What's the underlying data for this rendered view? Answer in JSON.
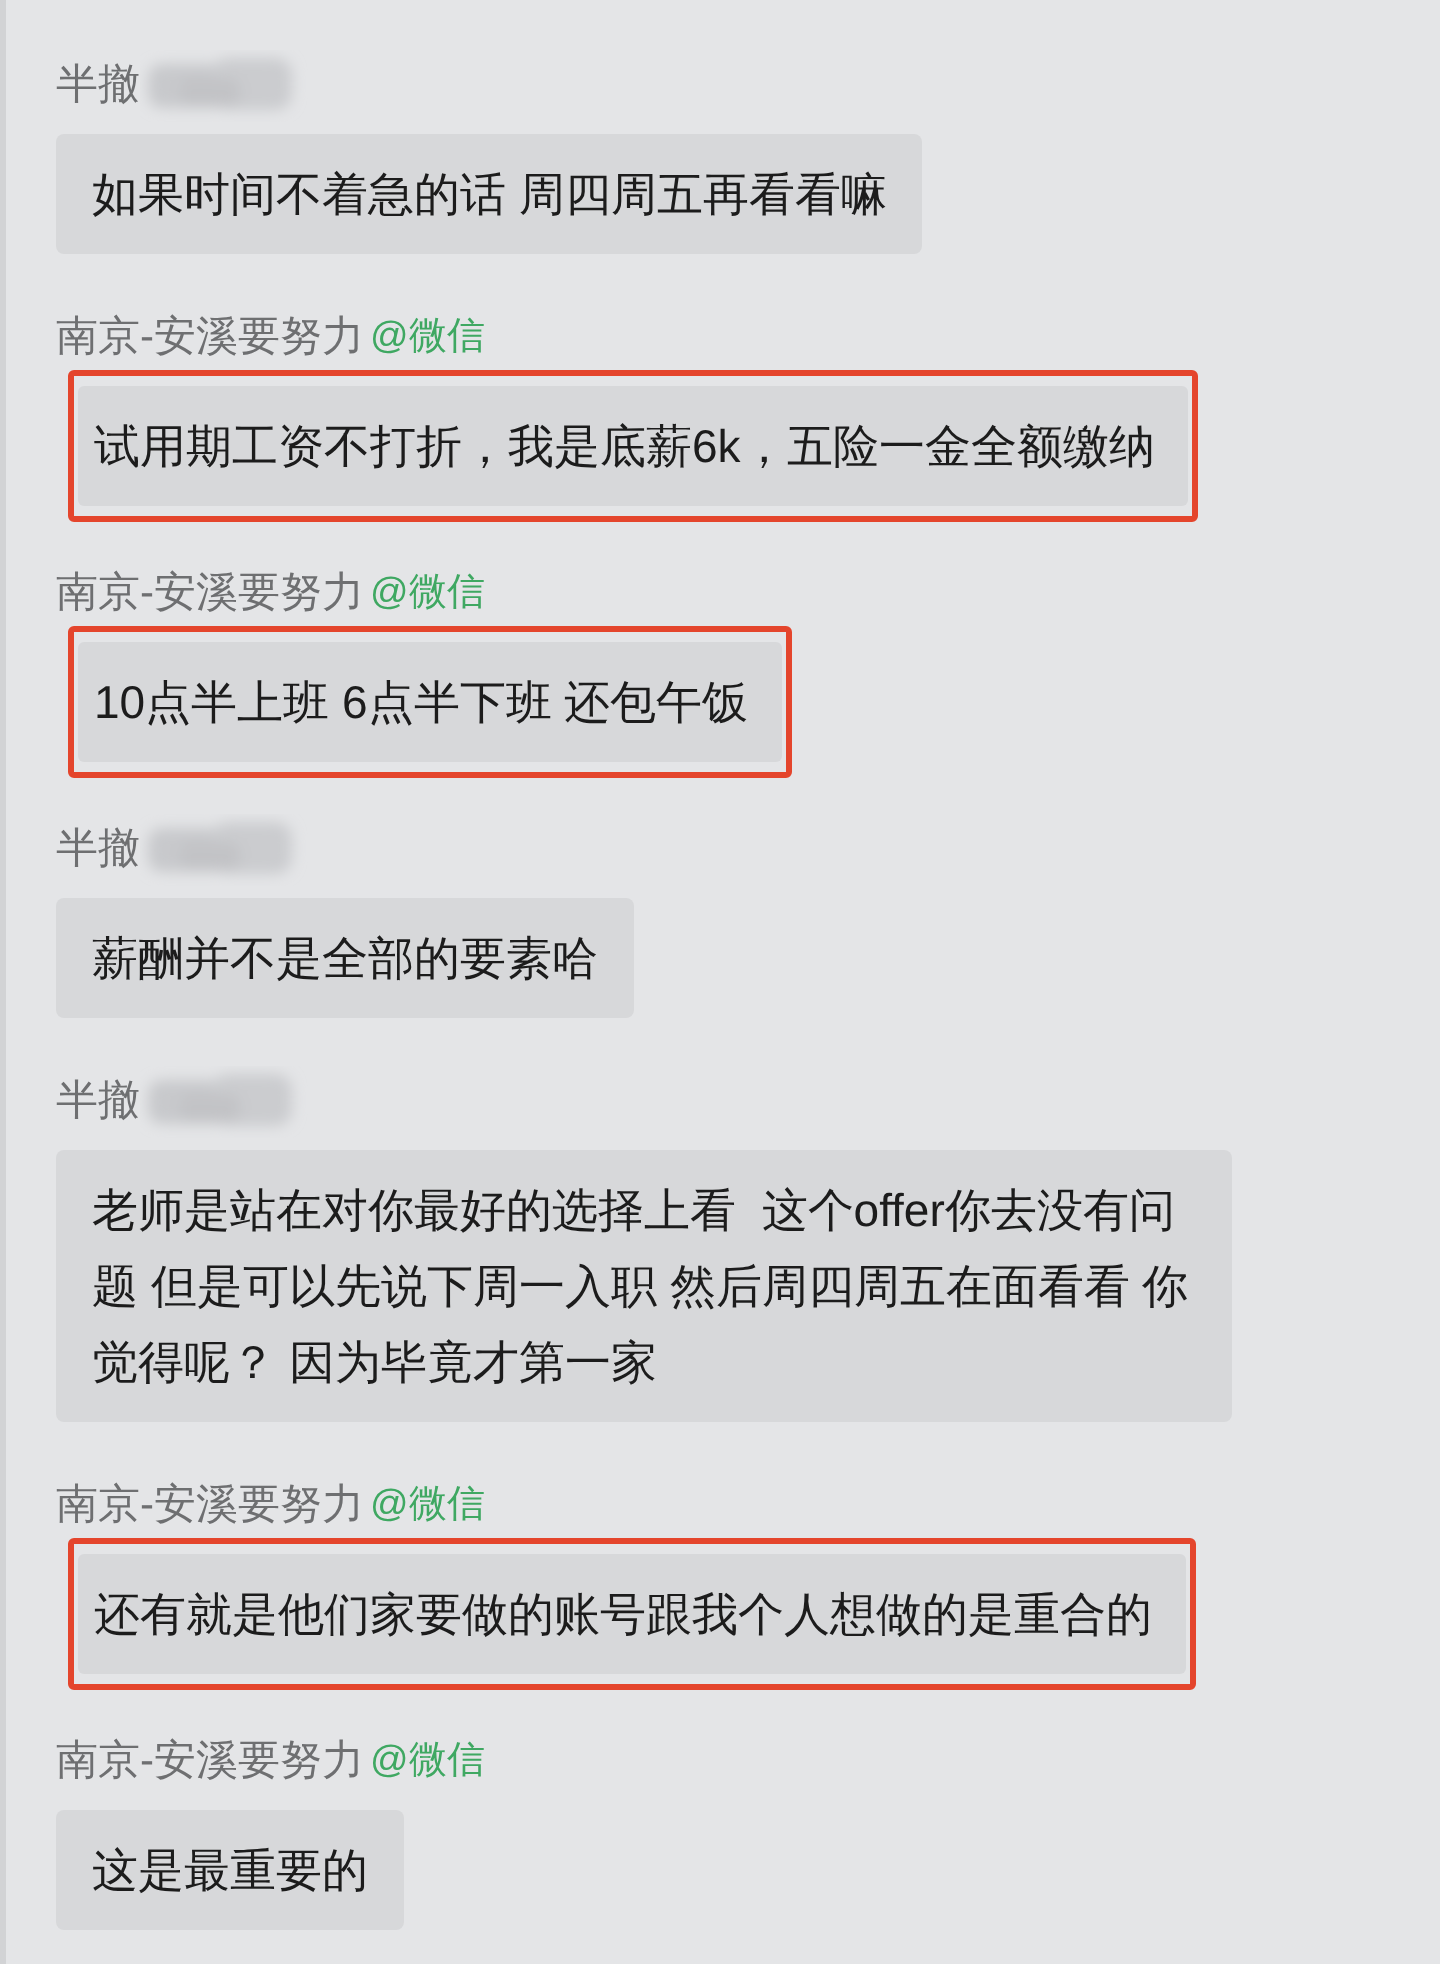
{
  "messages": [
    {
      "sender": {
        "name": "半撤",
        "redacted": true
      },
      "text": "如果时间不着急的话 周四周五再看看嘛",
      "highlighted": false
    },
    {
      "sender": {
        "name": "南京-安溪要努力",
        "source": "@微信",
        "redacted": false
      },
      "text": "试用期工资不打折，我是底薪6k，五险一金全额缴纳",
      "highlighted": true
    },
    {
      "sender": {
        "name": "南京-安溪要努力",
        "source": "@微信",
        "redacted": false
      },
      "text": "10点半上班 6点半下班 还包午饭",
      "highlighted": true
    },
    {
      "sender": {
        "name": "半撤",
        "redacted": true
      },
      "text": "薪酬并不是全部的要素哈",
      "highlighted": false
    },
    {
      "sender": {
        "name": "半撤",
        "redacted": true
      },
      "text": "老师是站在对你最好的选择上看  这个offer你去没有问题 但是可以先说下周一入职 然后周四周五在面看看 你觉得呢？ 因为毕竟才第一家",
      "highlighted": false
    },
    {
      "sender": {
        "name": "南京-安溪要努力",
        "source": "@微信",
        "redacted": false
      },
      "text": "还有就是他们家要做的账号跟我个人想做的是重合的",
      "highlighted": true
    },
    {
      "sender": {
        "name": "南京-安溪要努力",
        "source": "@微信",
        "redacted": false
      },
      "text": "这是最重要的",
      "highlighted": false
    }
  ]
}
